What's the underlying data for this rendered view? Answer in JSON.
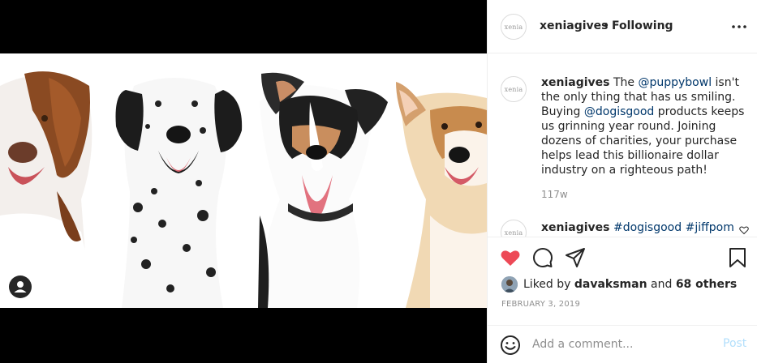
{
  "post": {
    "username": "xeniagives",
    "avatar_text": "xenia",
    "follow_separator": "•",
    "follow_status": "Following",
    "more_icon": "more-horizontal-icon"
  },
  "comments": [
    {
      "username": "xeniagives",
      "parts": {
        "t1": " The ",
        "m1": "@puppybowl",
        "t2": " isn't the only thing that has us smiling. Buying ",
        "m2": "@dogisgood",
        "t3": " products keeps us grinning year round. Joining dozens of charities, your purchase helps lead this billionaire dollar industry on a righteous path!"
      },
      "time": "117w"
    },
    {
      "username": "xeniagives",
      "hashtags": {
        "h1": "#dogisgood",
        "h2": "#jiffpom"
      }
    }
  ],
  "actions": {
    "like_icon": "heart-filled-icon",
    "comment_icon": "comment-icon",
    "share_icon": "paper-plane-icon",
    "save_icon": "bookmark-icon"
  },
  "likes": {
    "prefix": "Liked by ",
    "user": "davaksman",
    "middle": " and ",
    "others": "68 others"
  },
  "date": "FEBRUARY 3, 2019",
  "add_comment": {
    "placeholder": "Add a comment...",
    "post_label": "Post"
  },
  "colors": {
    "like_red": "#ed4956",
    "mention_blue": "#00376b",
    "post_disabled": "#b2dffc",
    "muted": "#8e8e8e"
  }
}
